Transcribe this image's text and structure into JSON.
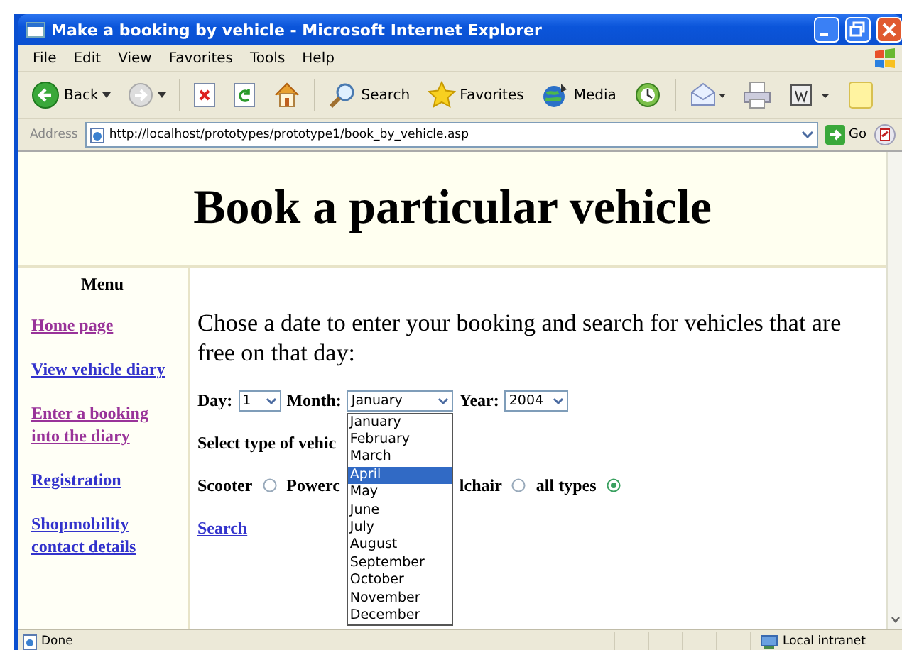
{
  "window": {
    "title": "Make a booking by vehicle - Microsoft Internet Explorer"
  },
  "menu_bar": [
    "File",
    "Edit",
    "View",
    "Favorites",
    "Tools",
    "Help"
  ],
  "toolbar": [
    {
      "kind": "back",
      "label": "Back"
    },
    {
      "kind": "forward"
    },
    {
      "kind": "stop"
    },
    {
      "kind": "refresh"
    },
    {
      "kind": "home"
    },
    {
      "kind": "search",
      "label": "Search"
    },
    {
      "kind": "favorites",
      "label": "Favorites"
    },
    {
      "kind": "media",
      "label": "Media"
    },
    {
      "kind": "history"
    },
    {
      "kind": "mail"
    },
    {
      "kind": "print"
    },
    {
      "kind": "edit"
    },
    {
      "kind": "note"
    }
  ],
  "address_bar": {
    "label": "Address",
    "value": "http://localhost/prototypes/prototype1/book_by_vehicle.asp",
    "go": "Go"
  },
  "page": {
    "heading": "Book a particular vehicle",
    "menu": {
      "title": "Menu",
      "links": [
        {
          "label": "Home page",
          "visited": true
        },
        {
          "label": "View vehicle diary",
          "visited": false
        },
        {
          "label": "Enter a booking into the diary",
          "visited": true
        },
        {
          "label": "Registration",
          "visited": false
        },
        {
          "label": "Shopmobility contact details",
          "visited": false
        }
      ]
    },
    "intro": "Chose a date to enter your booking and search for vehicles that are free on that day:",
    "date": {
      "day_label": "Day:",
      "day": "1",
      "month_label": "Month:",
      "month": "January",
      "year_label": "Year:",
      "year": "2004",
      "month_list": [
        {
          "label": "January",
          "selected": false
        },
        {
          "label": "February",
          "selected": false
        },
        {
          "label": "March",
          "selected": false
        },
        {
          "label": "April",
          "selected": true
        },
        {
          "label": "May",
          "selected": false
        },
        {
          "label": "June",
          "selected": false
        },
        {
          "label": "July",
          "selected": false
        },
        {
          "label": "August",
          "selected": false
        },
        {
          "label": "September",
          "selected": false
        },
        {
          "label": "October",
          "selected": false
        },
        {
          "label": "November",
          "selected": false
        },
        {
          "label": "December",
          "selected": false
        }
      ]
    },
    "vehicle_prompt": "Select type of vehic",
    "vehicle_options": [
      {
        "kind": "option",
        "label": "Scooter",
        "selected": false
      },
      {
        "kind": "clipped",
        "label": "Powerc"
      },
      {
        "kind": "option",
        "label": "lchair",
        "selected": false
      },
      {
        "kind": "option",
        "label": "all types",
        "selected": true
      }
    ],
    "search_link": "Search"
  },
  "status_bar": {
    "text": "Done",
    "zone": "Local intranet"
  }
}
